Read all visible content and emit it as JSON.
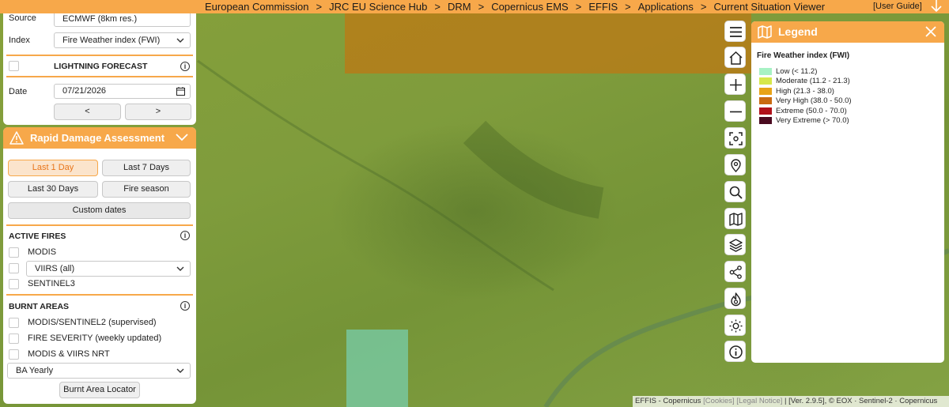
{
  "breadcrumbs": [
    "European Commission",
    "JRC EU Science Hub",
    "DRM",
    "Copernicus EMS",
    "EFFIS",
    "Applications",
    "Current Situation Viewer"
  ],
  "breadcrumb_separator": ">",
  "user_guide": "[User Guide]",
  "forecast": {
    "source_label": "Source",
    "source_value": "ECMWF (8km res.)",
    "index_label": "Index",
    "index_value": "Fire Weather index (FWI)",
    "lightning_label": "LIGHTNING FORECAST",
    "date_label": "Date",
    "date_value": "07/21/2026",
    "prev_label": "<",
    "next_label": ">"
  },
  "rda": {
    "title": "Rapid Damage Assessment",
    "periods": [
      "Last 1 Day",
      "Last 7 Days",
      "Last 30 Days",
      "Fire season"
    ],
    "custom_label": "Custom dates",
    "active_fires": {
      "title": "ACTIVE FIRES",
      "modis": "MODIS",
      "viirs_select": "VIIRS (all)",
      "sentinel3": "SENTINEL3"
    },
    "burnt_areas": {
      "title": "BURNT AREAS",
      "items": [
        "MODIS/SENTINEL2 (supervised)",
        "FIRE SEVERITY (weekly updated)",
        "MODIS & VIIRS NRT"
      ],
      "ba_select": "BA Yearly",
      "locator_label": "Burnt Area Locator"
    }
  },
  "legend": {
    "title": "Legend",
    "subtitle": "Fire Weather index (FWI)",
    "items": [
      {
        "label": "Low (< 11.2)",
        "color": "#a7f2c4"
      },
      {
        "label": "Moderate (11.2 - 21.3)",
        "color": "#d6e84a"
      },
      {
        "label": "High (21.3 - 38.0)",
        "color": "#e8a316"
      },
      {
        "label": "Very High (38.0 - 50.0)",
        "color": "#c96a10"
      },
      {
        "label": "Extreme (50.0 - 70.0)",
        "color": "#b0101a"
      },
      {
        "label": "Very Extreme (> 70.0)",
        "color": "#4a0a20"
      }
    ]
  },
  "attribution": {
    "text1": "EFFIS - Copernicus ",
    "cookies": "[Cookies]",
    "legal": " [Legal Notice]",
    "text2": " | [Ver. 2.9.5], © EOX · Sentinel-2 · Copernicus"
  },
  "colors": {
    "accent": "#f7a84a",
    "accent_text": "#e8761b"
  }
}
